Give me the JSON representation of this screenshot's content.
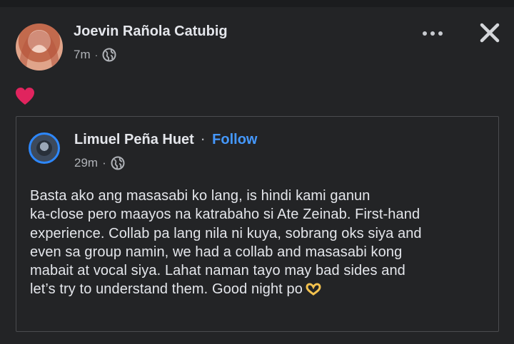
{
  "post": {
    "author": "Joevin Rañola Catubig",
    "time": "7m",
    "separator": "·",
    "privacy_icon": "globe-icon",
    "reaction_icon": "red-heart-icon",
    "more_icon": "more-dots-icon",
    "close_icon": "close-icon"
  },
  "shared_post": {
    "author": "Limuel Peña Huet",
    "separator": "·",
    "follow_label": "Follow",
    "time": "29m",
    "privacy_icon": "globe-icon",
    "body_lines": [
      "Basta ako ang masasabi ko lang, is hindi kami ganun",
      "ka-close pero maayos na katrabaho si Ate Zeinab. First-hand",
      "experience. Collab pa lang nila ni kuya, sobrang oks siya and",
      "even sa group namin, we had a collab and masasabi kong",
      "mabait at vocal siya. Lahat naman tayo may bad sides and",
      "let’s try to understand them. Good night po"
    ],
    "end_emoji_icon": "heart-hands-icon"
  },
  "colors": {
    "background": "#232426",
    "text_primary": "#e4e6eb",
    "text_secondary": "#b0b3b8",
    "link": "#4599ff",
    "heart": "#e0245e"
  }
}
